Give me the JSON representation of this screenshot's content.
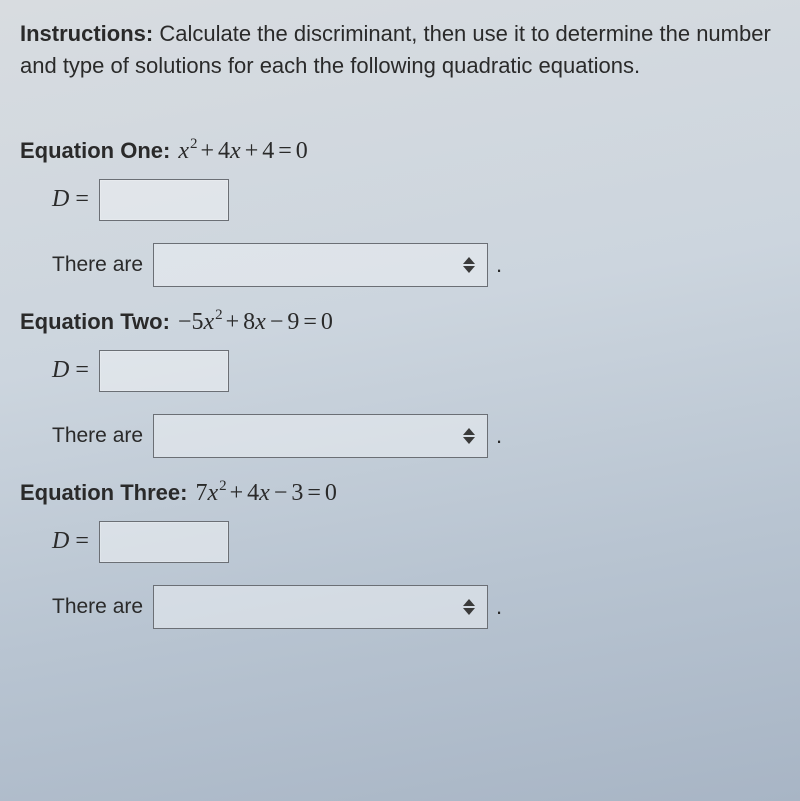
{
  "instructions": {
    "label": "Instructions:",
    "text": " Calculate the discriminant, then use it to determine the number and type of solutions for each the following quadratic equations."
  },
  "equations": [
    {
      "title": "Equation One:",
      "formula_prefix": "",
      "a": "",
      "term1_var": "x",
      "term1_exp": "2",
      "op1": "+",
      "b": "4",
      "term2_var": "x",
      "op2": "+",
      "c": "4",
      "eq": "=",
      "rhs": "0",
      "d_label": "D",
      "d_eq": "=",
      "d_value": "",
      "there_label": "There are",
      "select_value": "",
      "period": "."
    },
    {
      "title": "Equation Two:",
      "formula_prefix": "−",
      "a": "5",
      "term1_var": "x",
      "term1_exp": "2",
      "op1": "+",
      "b": "8",
      "term2_var": "x",
      "op2": "−",
      "c": "9",
      "eq": "=",
      "rhs": "0",
      "d_label": "D",
      "d_eq": "=",
      "d_value": "",
      "there_label": "There are",
      "select_value": "",
      "period": "."
    },
    {
      "title": "Equation Three:",
      "formula_prefix": "",
      "a": "7",
      "term1_var": "x",
      "term1_exp": "2",
      "op1": "+",
      "b": "4",
      "term2_var": "x",
      "op2": "−",
      "c": "3",
      "eq": "=",
      "rhs": "0",
      "d_label": "D",
      "d_eq": "=",
      "d_value": "",
      "there_label": "There are",
      "select_value": "",
      "period": "."
    }
  ]
}
